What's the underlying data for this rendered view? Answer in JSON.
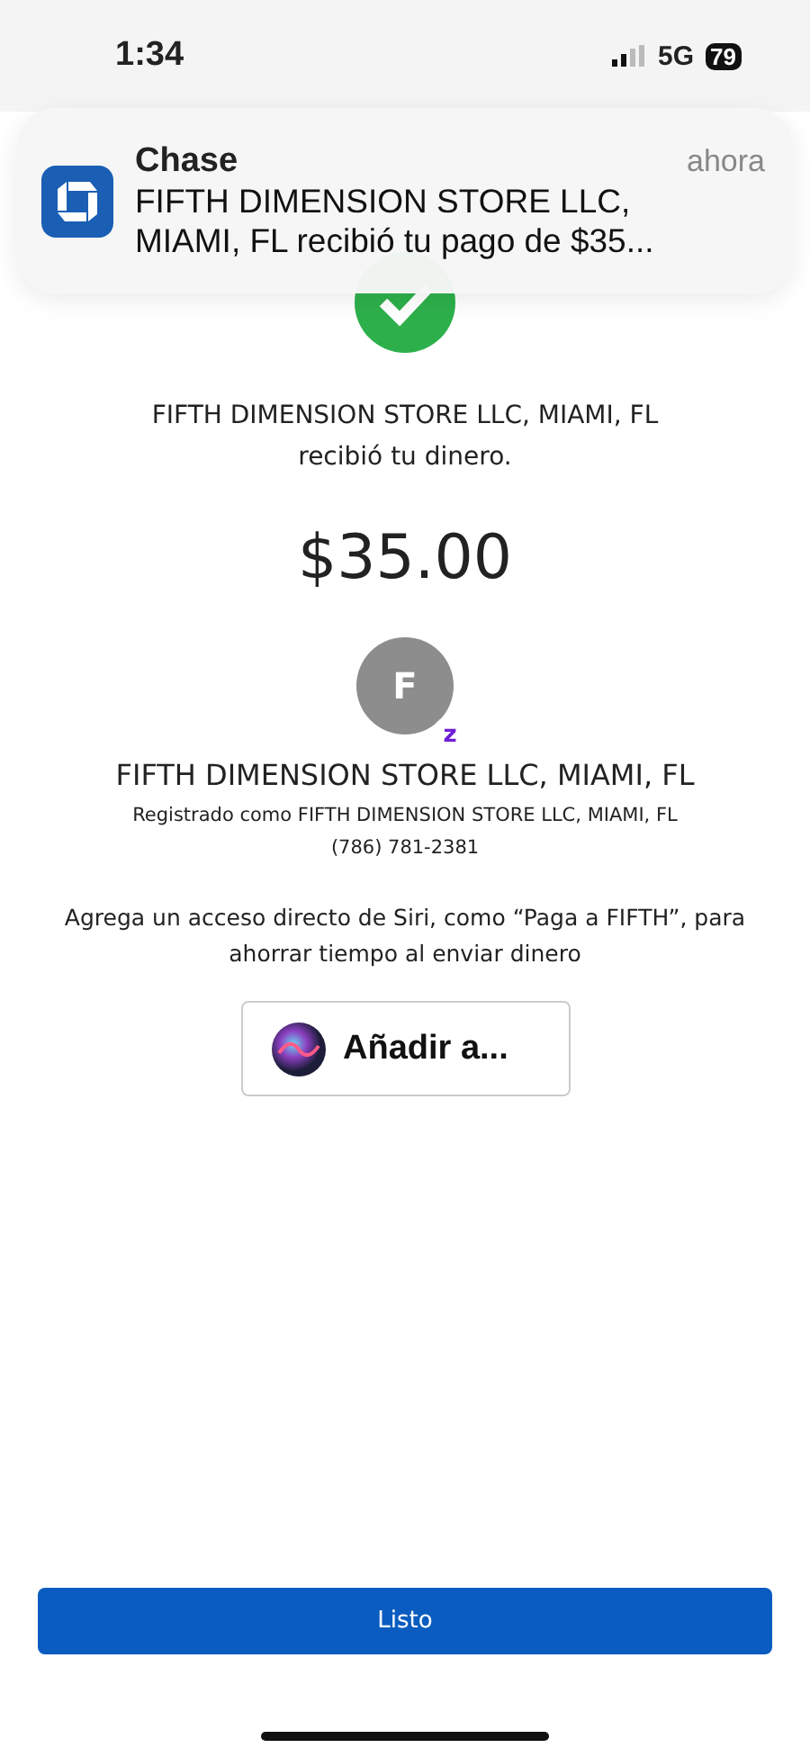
{
  "status_bar": {
    "time": "1:34",
    "network": "5G",
    "battery": "79"
  },
  "notification": {
    "app": "Chase",
    "time": "ahora",
    "message": "FIFTH DIMENSION STORE LLC, MIAMI, FL recibió tu pago de $35..."
  },
  "confirmation": {
    "message": "FIFTH DIMENSION STORE LLC, MIAMI, FL recibió tu dinero.",
    "amount": "$35.00"
  },
  "recipient": {
    "initial": "F",
    "badge": "z",
    "name": "FIFTH DIMENSION STORE LLC, MIAMI, FL",
    "registered": "Registrado como FIFTH DIMENSION STORE LLC, MIAMI, FL",
    "phone": "(786) 781-2381"
  },
  "siri": {
    "text": "Agrega un acceso directo de Siri, como “Paga a FIFTH”, para ahorrar tiempo al enviar dinero",
    "button": "Añadir a..."
  },
  "done_button": "Listo"
}
